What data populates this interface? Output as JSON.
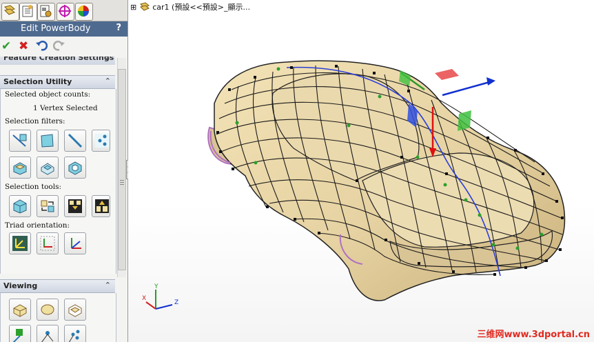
{
  "panel": {
    "title": "Edit PowerBody",
    "help": "?",
    "cut_header": "Feature Creation Settings",
    "sections": {
      "selection_utility": {
        "title": "Selection Utility",
        "counts_label": "Selected object counts:",
        "counts_value": "1 Vertex Selected",
        "filters_label": "Selection filters:",
        "tools_label": "Selection tools:",
        "triad_label": "Triad orientation:"
      },
      "viewing": {
        "title": "Viewing"
      }
    }
  },
  "tree": {
    "expander": "⊞",
    "item": "car1 (預設<<預設>_顯示..."
  },
  "axes": {
    "y": "Y",
    "x": "X",
    "z": "Z"
  },
  "watermark": "三维网www.3dportal.cn",
  "colors": {
    "title_bar": "#4f6a8f",
    "body": "#e6d2a3",
    "wire": "#1a1a1a",
    "centerline": "#2a3ed8",
    "node": "#2ca02c",
    "edge_purple": "#b070c0"
  }
}
